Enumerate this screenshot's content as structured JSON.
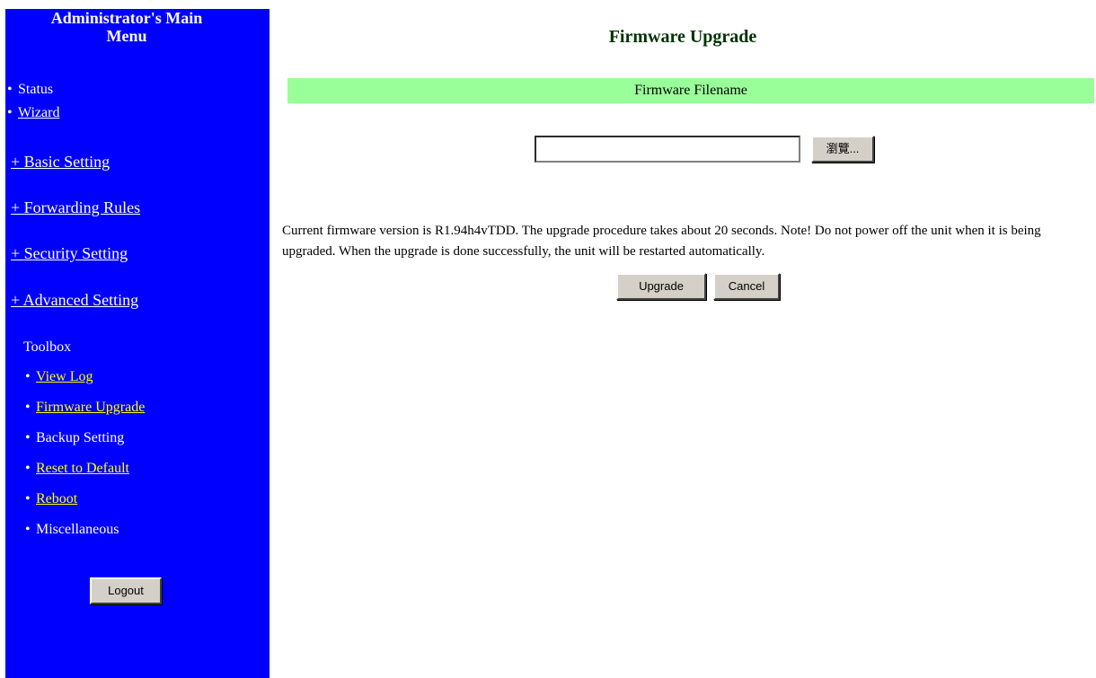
{
  "sidebar": {
    "title_line1": "Administrator's Main",
    "title_line2": "Menu",
    "links": [
      {
        "label": "Status"
      },
      {
        "label": "Wizard"
      }
    ],
    "sections": [
      {
        "label": "+ Basic Setting"
      },
      {
        "label": "+ Forwarding Rules"
      },
      {
        "label": "+ Security Setting"
      },
      {
        "label": "+ Advanced Setting"
      }
    ],
    "toolbox_title": "Toolbox",
    "toolbox": [
      {
        "label": "View Log"
      },
      {
        "label": "Firmware Upgrade"
      },
      {
        "label": "Backup Setting"
      },
      {
        "label": "Reset to Default"
      },
      {
        "label": "Reboot"
      },
      {
        "label": "Miscellaneous"
      }
    ],
    "logout_label": "Logout"
  },
  "main": {
    "title": "Firmware Upgrade",
    "filename_header": "Firmware Filename",
    "file_input_value": "",
    "browse_label": "瀏覽...",
    "info_text": "Current firmware version is R1.94h4vTDD. The upgrade procedure takes about 20 seconds. Note! Do not power off the unit when it is being upgraded. When the upgrade is done successfully, the unit will be restarted automatically.",
    "upgrade_label": "Upgrade",
    "cancel_label": "Cancel"
  },
  "colors": {
    "sidebar_bg": "#0000ff",
    "header_bar_bg": "#99ff99",
    "current_link": "#ffff00"
  }
}
